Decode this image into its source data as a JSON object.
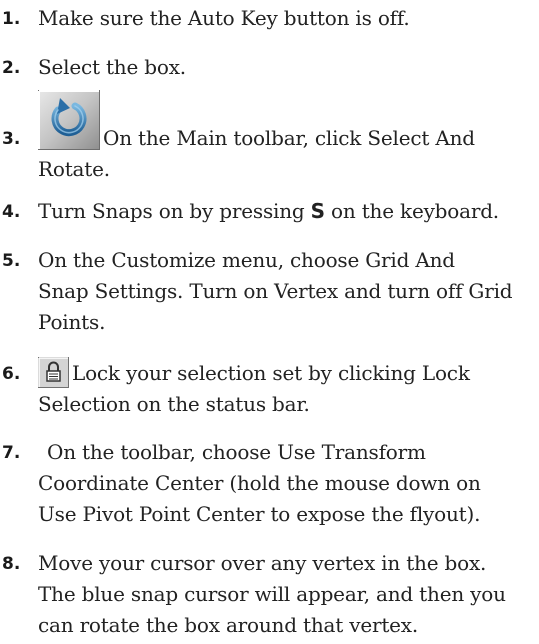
{
  "steps": [
    {
      "number": "1.",
      "text": "Make sure the Auto Key button is off."
    },
    {
      "number": "2.",
      "text": "Select the box."
    },
    {
      "number": "3.",
      "icon": "select-and-rotate-icon",
      "line1": "On the Main toolbar, click Select And",
      "line2": "Rotate."
    },
    {
      "number": "4.",
      "text_before": "Turn Snaps on by pressing ",
      "key": "S",
      "text_after": " on the keyboard."
    },
    {
      "number": "5.",
      "line1": "On the Customize menu, choose Grid And",
      "line2": "Snap Settings. Turn on Vertex and turn off Grid",
      "line3": "Points."
    },
    {
      "number": "6.",
      "icon": "lock-selection-icon",
      "line1": "Lock your selection set by clicking Lock",
      "line2": "Selection on the status bar."
    },
    {
      "number": "7.",
      "line1": "On the toolbar, choose Use Transform",
      "line2": "Coordinate Center (hold the mouse down on",
      "line3": "Use Pivot Point Center to expose the flyout)."
    },
    {
      "number": "8.",
      "line1": "Move your cursor over any vertex in the box.",
      "line2": "The blue snap cursor will appear, and then you",
      "line3": "can rotate the box around that vertex."
    }
  ]
}
